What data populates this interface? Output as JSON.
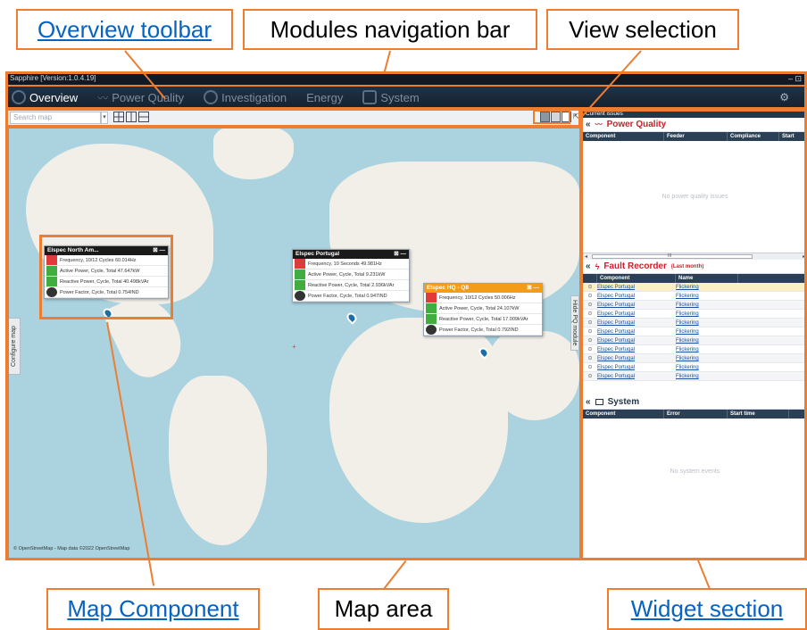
{
  "callouts": {
    "overview_toolbar": "Overview toolbar",
    "modules_nav": "Modules navigation bar",
    "view_selection": "View selection",
    "map_component": "Map Component",
    "map_area": "Map area",
    "widget_section": "Widget section"
  },
  "app": {
    "title": "Sapphire [Version:1.0.4.19]",
    "window_controls": "– ⊡",
    "modules": [
      "Overview",
      "Power Quality",
      "Investigation",
      "Energy",
      "System"
    ]
  },
  "toolbar": {
    "search_placeholder": "Search map",
    "dropdown_icon": "▾"
  },
  "map": {
    "configure_tab": "Configure map",
    "hide_pq_tab": "Hide PQ module",
    "attribution": "© OpenStreetMap - Map data ©2022 OpenStreetMap",
    "popups": [
      {
        "title": "Elspec North Am...",
        "controls": "⊠ —",
        "rows": [
          "Frequency, 10/12 Cycles 60.014Hz",
          "Active Power, Cycle, Total 47.647kW",
          "Reactive Power, Cycle, Total 40.498kVAr",
          "Power Factor, Cycle, Total 0.754IND"
        ]
      },
      {
        "title": "Elspec Portugal",
        "controls": "⊠ —",
        "rows": [
          "Frequency, 10 Seconds 49.981Hz",
          "Active Power, Cycle, Total 9.231kW",
          "Reactive Power, Cycle, Total 2.936kVAr",
          "Power Factor, Cycle, Total 0.947IND"
        ]
      },
      {
        "title": "Elspec HQ - Q8",
        "controls": "⊠ —",
        "rows": [
          "Frequency, 10/12 Cycles 50.006Hz",
          "Active Power, Cycle, Total 24.107kW",
          "Reactive Power, Cycle, Total 17.009kVAr",
          "Power Factor, Cycle, Total 0.792IND"
        ]
      }
    ]
  },
  "widgets": {
    "title": "Current issues",
    "power_quality": {
      "label": "Power Quality",
      "columns": [
        "Component",
        "Feeder",
        "Compliance",
        "Start"
      ],
      "empty": "No power quality issues",
      "scroll_mid": "III"
    },
    "fault_recorder": {
      "label": "Fault Recorder",
      "sub": "(Last month)",
      "columns": [
        "Component",
        "Name"
      ],
      "rows": [
        {
          "component": "Elspec Portugal",
          "name": "Flickering"
        },
        {
          "component": "Elspec Portugal",
          "name": "Flickering"
        },
        {
          "component": "Elspec Portugal",
          "name": "Flickering"
        },
        {
          "component": "Elspec Portugal",
          "name": "Flickering"
        },
        {
          "component": "Elspec Portugal",
          "name": "Flickering"
        },
        {
          "component": "Elspec Portugal",
          "name": "Flickering"
        },
        {
          "component": "Elspec Portugal",
          "name": "Flickering"
        },
        {
          "component": "Elspec Portugal",
          "name": "Flickering"
        },
        {
          "component": "Elspec Portugal",
          "name": "Flickering"
        },
        {
          "component": "Elspec Portugal",
          "name": "Flickering"
        },
        {
          "component": "Elspec Portugal",
          "name": "Flickering"
        }
      ]
    },
    "system": {
      "label": "System",
      "columns": [
        "Component",
        "Error",
        "Start time"
      ],
      "empty": "No system events"
    }
  },
  "colors": {
    "accent": "#ed7d31",
    "link": "#0563c1",
    "app_bg": "#1c2a3a",
    "map_water": "#aad3df",
    "map_land": "#f2efe9",
    "alert_red": "#c8212b"
  }
}
